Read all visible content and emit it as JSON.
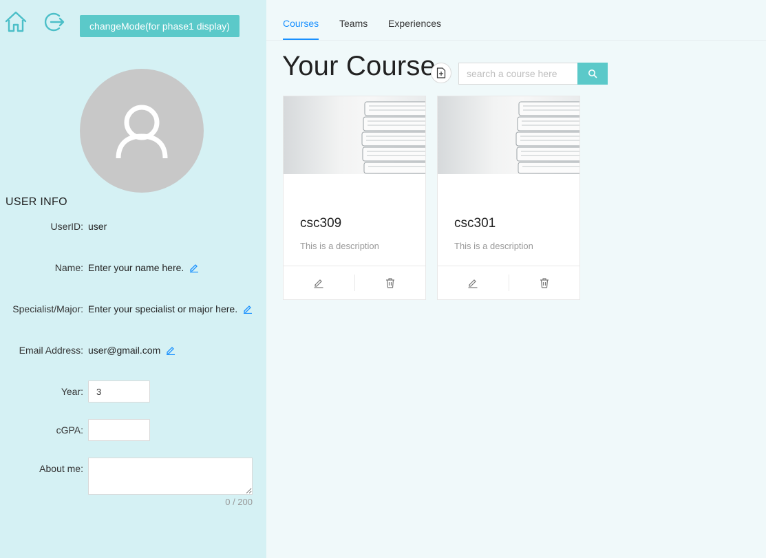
{
  "sidebar": {
    "home_icon": "home-icon",
    "logout_icon": "logout-icon",
    "mode_button": "changeMode(for phase1 display)",
    "avatar_icon": "user-icon",
    "section_title": "USER INFO",
    "fields": {
      "userid": {
        "label": "UserID:",
        "value": "user"
      },
      "name": {
        "label": "Name:",
        "value": "Enter your name here."
      },
      "major": {
        "label": "Specialist/Major:",
        "value": "Enter your specialist or major here."
      },
      "email": {
        "label": "Email Address:",
        "value": "user@gmail.com"
      },
      "year": {
        "label": "Year:",
        "value": "3"
      },
      "cgpa": {
        "label": "cGPA:",
        "value": ""
      },
      "about": {
        "label": "About me:",
        "value": "",
        "counter": "0 / 200"
      }
    }
  },
  "tabs": [
    {
      "label": "Courses",
      "active": true
    },
    {
      "label": "Teams",
      "active": false
    },
    {
      "label": "Experiences",
      "active": false
    }
  ],
  "main": {
    "title": "Your Course",
    "search_placeholder": "search a course here",
    "accent_color": "#5bc9c9",
    "link_color": "#1890ff"
  },
  "courses": [
    {
      "title": "csc309",
      "description": "This is a description"
    },
    {
      "title": "csc301",
      "description": "This is a description"
    }
  ]
}
